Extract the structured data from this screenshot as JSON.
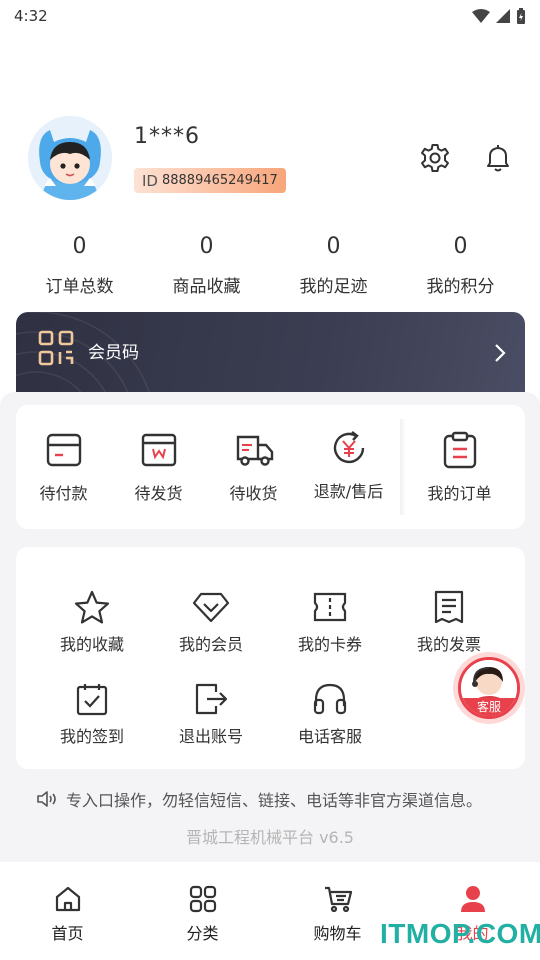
{
  "status_bar": {
    "time": "4:32"
  },
  "profile": {
    "username": "1***6",
    "id_prefix": "ID",
    "id_value": "88889465249417"
  },
  "stats": [
    {
      "value": "0",
      "label": "订单总数"
    },
    {
      "value": "0",
      "label": "商品收藏"
    },
    {
      "value": "0",
      "label": "我的足迹"
    },
    {
      "value": "0",
      "label": "我的积分"
    }
  ],
  "member_card": {
    "label": "会员码"
  },
  "orders": [
    {
      "label": "待付款",
      "icon": "wallet-icon"
    },
    {
      "label": "待发货",
      "icon": "package-icon"
    },
    {
      "label": "待收货",
      "icon": "truck-icon"
    },
    {
      "label": "退款/售后",
      "icon": "refund-icon"
    },
    {
      "label": "我的订单",
      "icon": "clipboard-icon"
    }
  ],
  "services": [
    {
      "label": "我的收藏",
      "icon": "star-icon"
    },
    {
      "label": "我的会员",
      "icon": "diamond-icon"
    },
    {
      "label": "我的卡券",
      "icon": "coupon-icon"
    },
    {
      "label": "我的发票",
      "icon": "invoice-icon"
    },
    {
      "label": "我的签到",
      "icon": "checkin-icon"
    },
    {
      "label": "退出账号",
      "icon": "logout-icon"
    },
    {
      "label": "电话客服",
      "icon": "headset-icon"
    }
  ],
  "customer_service": {
    "label": "客服"
  },
  "notice": {
    "text": "专入口操作，勿轻信短信、链接、电话等非官方渠道信息。"
  },
  "version": "晋城工程机械平台 v6.5",
  "tabbar": [
    {
      "label": "首页",
      "icon": "home-icon"
    },
    {
      "label": "分类",
      "icon": "category-icon"
    },
    {
      "label": "购物车",
      "icon": "cart-icon"
    },
    {
      "label": "我的",
      "icon": "profile-icon",
      "active": true
    }
  ],
  "watermark": "ITMOP.COM",
  "colors": {
    "accent": "#e8414b",
    "badge_start": "#fde2d4",
    "badge_end": "#f8a57a",
    "member_card": "#34364a",
    "watermark": "#21b0a3"
  }
}
